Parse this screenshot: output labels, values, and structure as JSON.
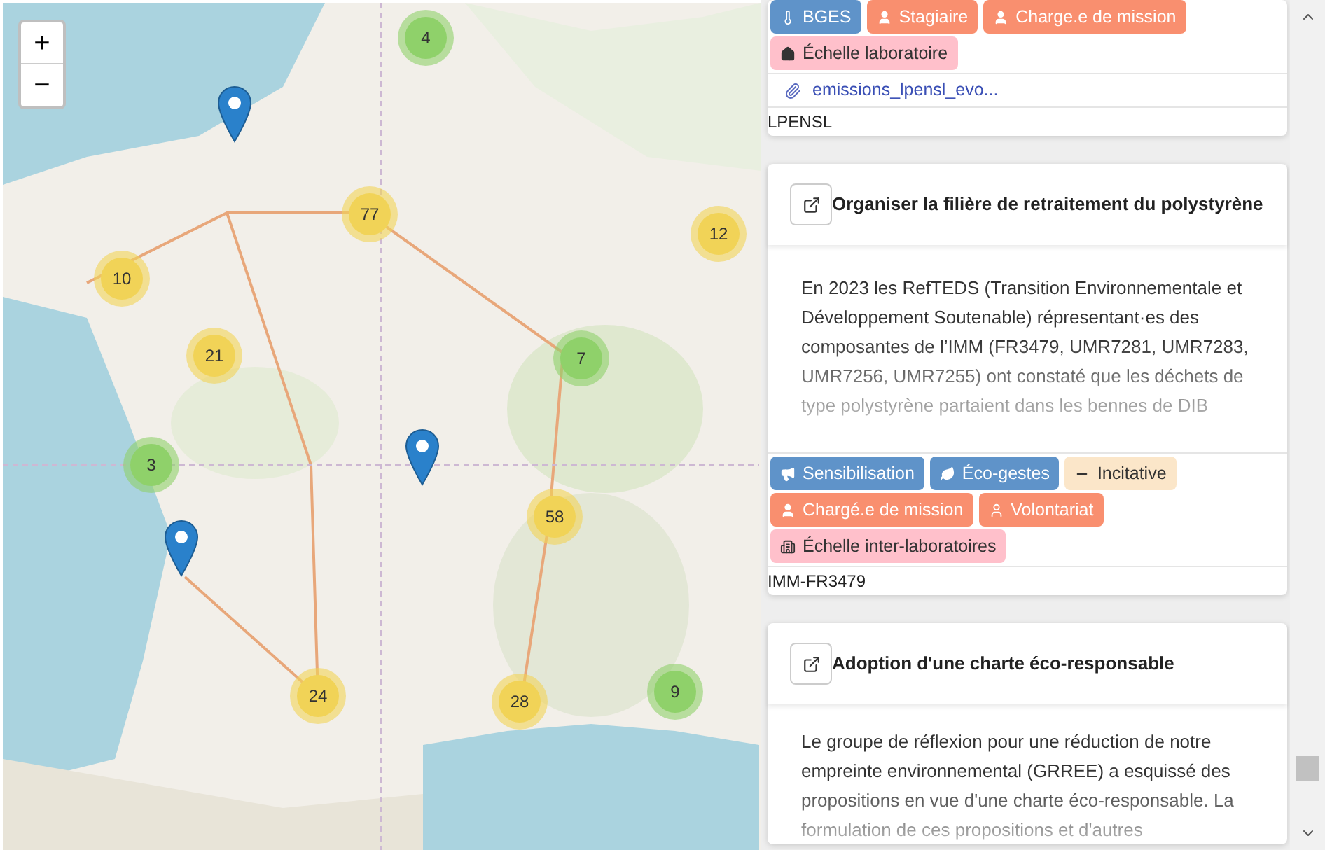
{
  "map": {
    "zoom_in": "+",
    "zoom_out": "−",
    "clusters": [
      {
        "count": "4",
        "color": "#8fd16a"
      },
      {
        "count": "77",
        "color": "#f1d357"
      },
      {
        "count": "12",
        "color": "#f1d357"
      },
      {
        "count": "10",
        "color": "#f1d357"
      },
      {
        "count": "21",
        "color": "#f1d357"
      },
      {
        "count": "7",
        "color": "#8fd16a"
      },
      {
        "count": "3",
        "color": "#8fd16a"
      },
      {
        "count": "58",
        "color": "#f1d357"
      },
      {
        "count": "24",
        "color": "#f1d357"
      },
      {
        "count": "28",
        "color": "#f1d357"
      },
      {
        "count": "9",
        "color": "#8fd16a"
      }
    ]
  },
  "cards": [
    {
      "tags": [
        {
          "label": "BGES",
          "kind": "bges"
        },
        {
          "label": "Stagiaire",
          "kind": "intern"
        },
        {
          "label": "Charge.e de mission",
          "kind": "officer"
        },
        {
          "label": "Échelle laboratoire",
          "kind": "lab-scale"
        }
      ],
      "attachment": "emissions_lpensl_evo...",
      "footer": "LPENSL"
    },
    {
      "title": "Organiser la filière de retraitement du polystyrène",
      "description": "En 2023 les RefTEDS (Transition Environnementale et Développement Soutenable) répresentant·es des composantes de l’IMM (FR3479, UMR7281, UMR7283, UMR7256, UMR7255) ont constaté que les déchets de type polystyrène partaient dans les bennes de DIB",
      "tags": [
        {
          "label": "Sensibilisation",
          "kind": "awareness"
        },
        {
          "label": "Éco-gestes",
          "kind": "eco-gestures"
        },
        {
          "label": "Incitative",
          "kind": "incentive"
        },
        {
          "label": "Chargé.e de mission",
          "kind": "officer"
        },
        {
          "label": "Volontariat",
          "kind": "volunteer"
        },
        {
          "label": "Échelle inter-laboratoires",
          "kind": "inter-lab-scale"
        }
      ],
      "footer": "IMM-FR3479"
    },
    {
      "title": "Adoption d'une charte éco-responsable",
      "description": "Le groupe de réflexion pour une réduction de notre empreinte environnemental (GRREE) a esquissé des propositions en vue d'une charte éco-responsable. La formulation de ces propositions et d'autres"
    }
  ]
}
